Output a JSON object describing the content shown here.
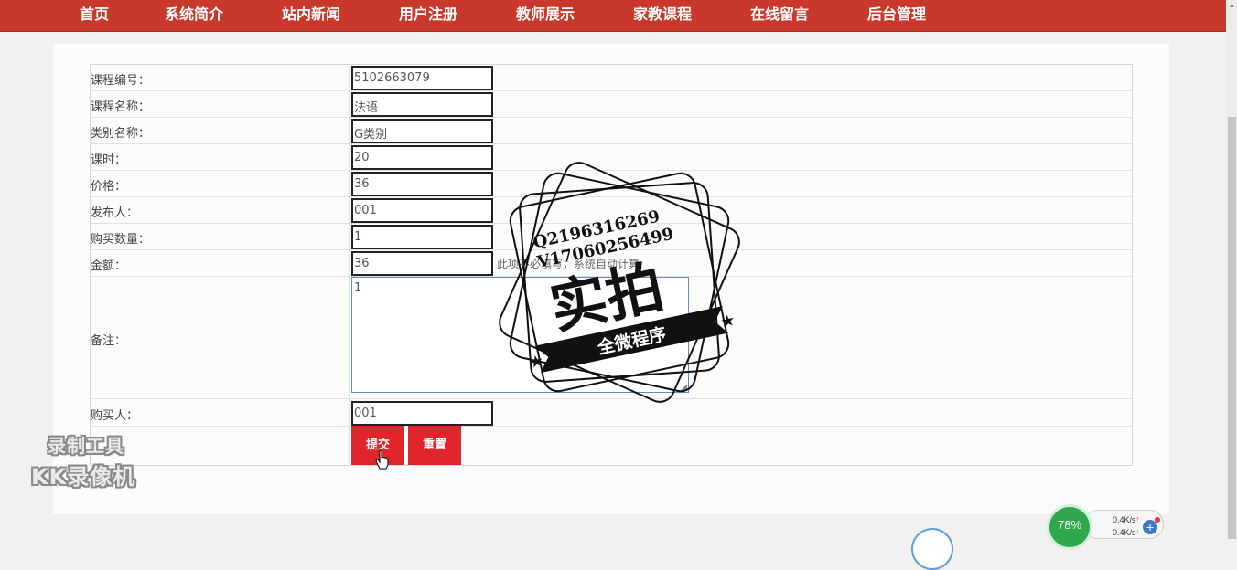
{
  "nav": {
    "items": [
      {
        "label": "首页"
      },
      {
        "label": "系统简介"
      },
      {
        "label": "站内新闻"
      },
      {
        "label": "用户注册"
      },
      {
        "label": "教师展示"
      },
      {
        "label": "家教课程"
      },
      {
        "label": "在线留言"
      },
      {
        "label": "后台管理"
      }
    ]
  },
  "form": {
    "fields": [
      {
        "label": "课程编号：",
        "value": "5102663079"
      },
      {
        "label": "课程名称：",
        "value": "法语"
      },
      {
        "label": "类别名称：",
        "value": "G类别"
      },
      {
        "label": "课时：",
        "value": "20"
      },
      {
        "label": "价格：",
        "value": "36"
      },
      {
        "label": "发布人：",
        "value": "001"
      },
      {
        "label": "购买数量：",
        "value": "1"
      },
      {
        "label": "金额：",
        "value": "36"
      }
    ],
    "amount_hint": "此项不必填写，系统自动计算",
    "remark": {
      "label": "备注：",
      "value": "1"
    },
    "buyer": {
      "label": "购买人：",
      "value": "001"
    },
    "submit_label": "提交",
    "reset_label": "重置"
  },
  "watermark": {
    "line1": "Q2196316269",
    "line2": "V17060256499",
    "main": "实拍",
    "ribbon": "全微程序"
  },
  "recorder": {
    "line1": "录制工具",
    "line2": "KK录像机"
  },
  "net_widget": {
    "percent": "78%",
    "up_speed": "0.4K/s",
    "down_speed": "0.4K/s",
    "accent": "#2ea84a"
  },
  "colors": {
    "nav_bg": "#c9392b",
    "button_bg": "#e0262c"
  }
}
